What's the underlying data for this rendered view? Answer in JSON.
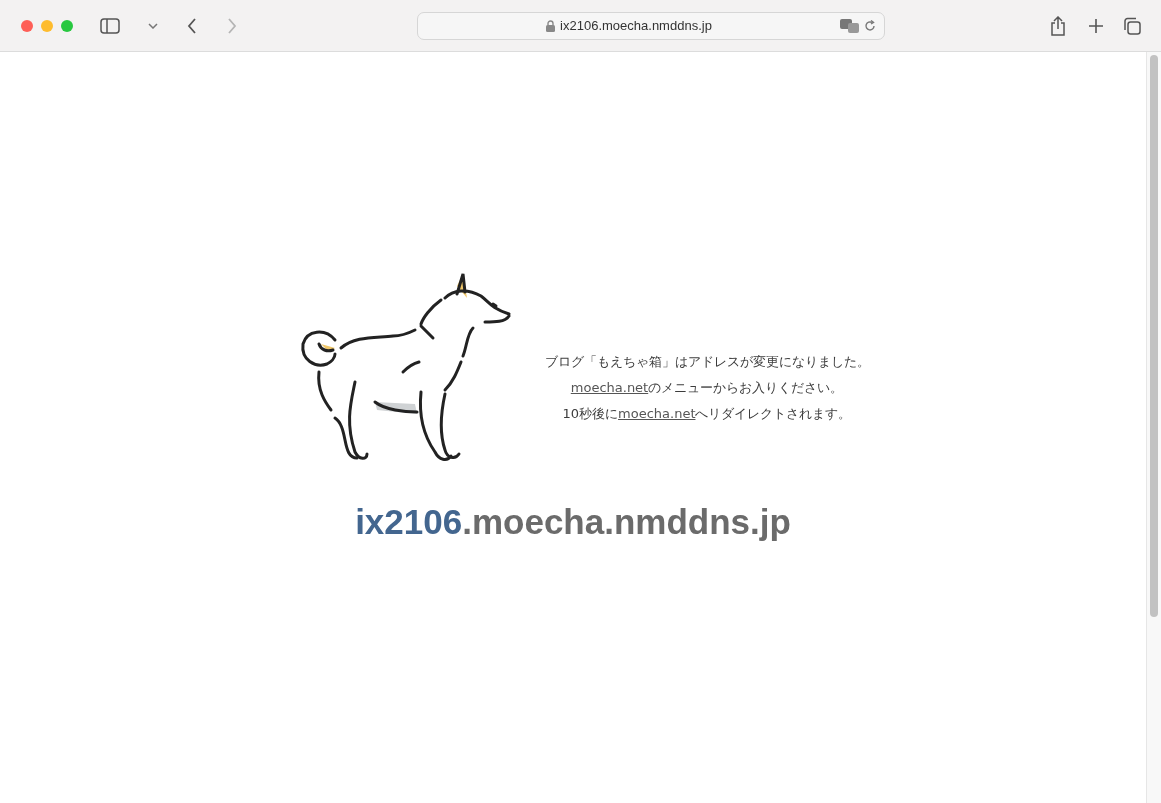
{
  "browser": {
    "url": "ix2106.moecha.nmddns.jp",
    "back_disabled": false,
    "forward_disabled": true
  },
  "message": {
    "lines": [
      [
        {
          "text": "ブログ「もえちゃ箱」はアドレスが変更になりました。",
          "link": false
        }
      ],
      [
        {
          "text": "moecha.net",
          "link": true
        },
        {
          "text": "のメニューからお入りください。",
          "link": false
        }
      ],
      [
        {
          "text": "10秒後に",
          "link": false
        },
        {
          "text": "moecha.net",
          "link": true
        },
        {
          "text": "へリダイレクトされます。",
          "link": false
        }
      ]
    ]
  },
  "hostname": {
    "parts": [
      {
        "text": "ix2106",
        "color": "#43668f"
      },
      {
        "text": ".moecha.nmddns.jp",
        "color": "#6b6b6b"
      }
    ]
  }
}
